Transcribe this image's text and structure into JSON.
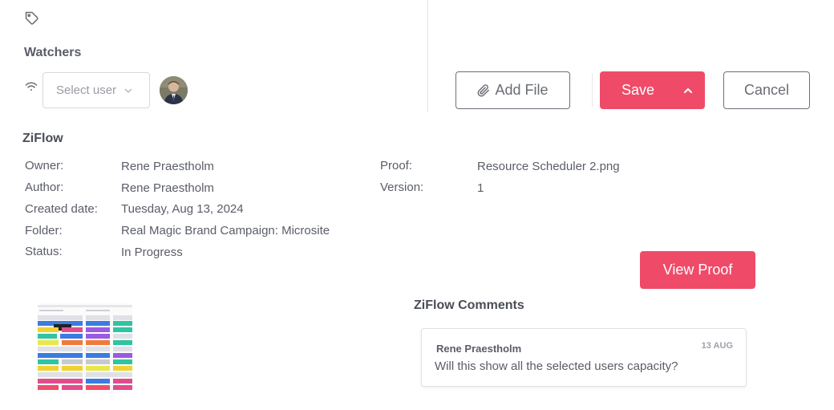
{
  "watchers": {
    "heading": "Watchers",
    "select_placeholder": "Select user"
  },
  "actions": {
    "add_file_label": "Add File",
    "save_label": "Save",
    "cancel_label": "Cancel"
  },
  "ziflow": {
    "heading": "ZiFlow",
    "owner_label": "Owner:",
    "owner_value": "Rene Praestholm",
    "author_label": "Author:",
    "author_value": "Rene Praestholm",
    "created_label": "Created date:",
    "created_value": "Tuesday, Aug 13, 2024",
    "folder_label": "Folder:",
    "folder_value": "Real Magic Brand Campaign: Microsite",
    "status_label": "Status:",
    "status_value": "In Progress",
    "proof_label": "Proof:",
    "proof_value": "Resource Scheduler 2.png",
    "version_label": "Version:",
    "version_value": "1",
    "view_proof_label": "View Proof"
  },
  "comments": {
    "heading": "ZiFlow Comments",
    "items": [
      {
        "author": "Rene Praestholm",
        "date": "13 AUG",
        "text": "Will this show all the selected users capacity?"
      }
    ]
  },
  "colors": {
    "accent": "#ef4b68",
    "text": "#5a5d68",
    "border": "#d9d9de"
  },
  "icons": [
    "tag-icon",
    "wifi-icon",
    "chevron-down-icon",
    "paperclip-icon",
    "chevron-up-icon"
  ]
}
